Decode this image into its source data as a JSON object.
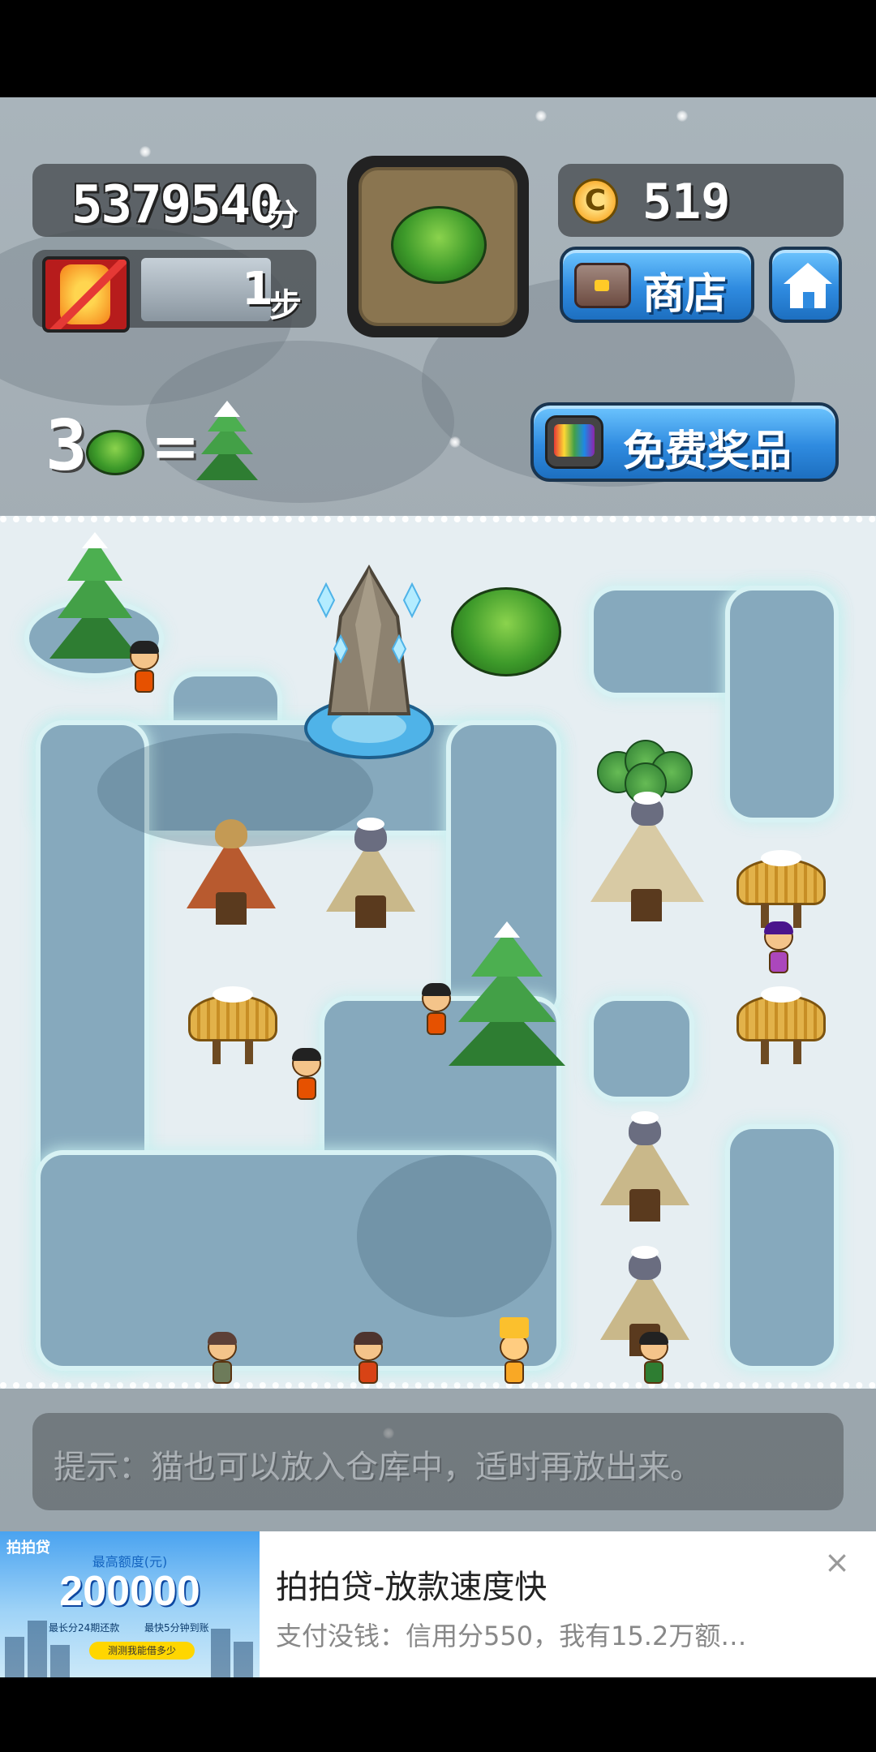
{
  "hud": {
    "score": "5379540",
    "score_unit": "分",
    "steps": "1",
    "steps_unit": "步",
    "coins": "519",
    "coin_icon_letter": "C",
    "shop_label": "商店",
    "free_prize_label": "免费奖品",
    "next_item": "bush"
  },
  "recipe": {
    "count": "3",
    "equals": "="
  },
  "hint": {
    "text": "提示：猫也可以放入仓库中，适时再放出来。"
  },
  "ad": {
    "image_logo": "拍拍贷",
    "image_caption": "最高额度(元)",
    "image_amount": "200000",
    "image_line_1": "最长分24期还款",
    "image_line_2": "最快5分钟到账",
    "image_button": "测测我能借多少",
    "title": "拍拍贷-放款速度快",
    "description": "支付没钱：信用分550，我有15.2万额…",
    "close_glyph": "×"
  },
  "colors": {
    "accent_blue": "#2f8be0",
    "water": "#86a9bd",
    "snow": "#e6eef2"
  }
}
